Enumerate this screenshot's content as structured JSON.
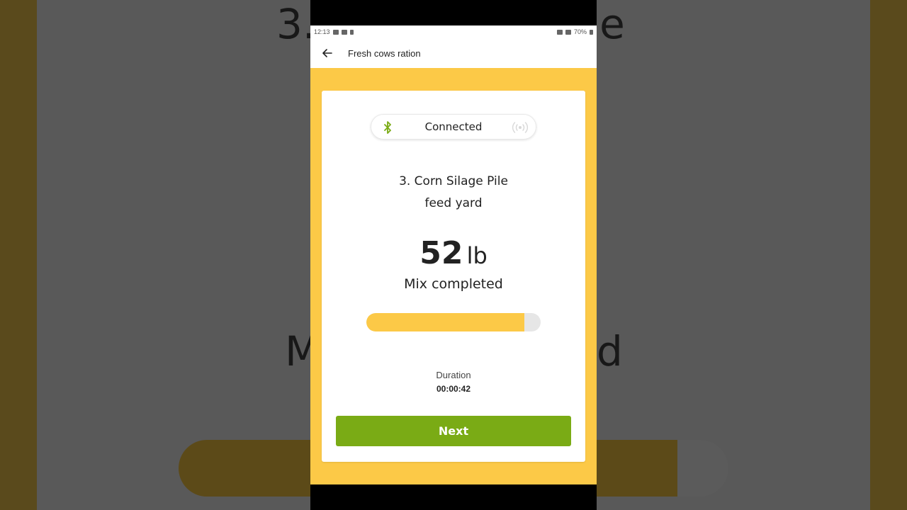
{
  "background": {
    "echo_top": "3.",
    "echo_top_right": "le",
    "echo_mid_left": "M",
    "echo_mid_right": "d"
  },
  "statusbar": {
    "time": "12:13",
    "battery": "70%"
  },
  "appbar": {
    "back_icon": "arrow-left-icon",
    "title": "Fresh cows ration"
  },
  "connection": {
    "status": "Connected",
    "bluetooth_icon": "bluetooth-icon",
    "signal_icon": "broadcast-signal-icon",
    "bluetooth_color": "#7aab15"
  },
  "item": {
    "line1": "3. Corn Silage Pile",
    "line2": "feed yard"
  },
  "weight": {
    "value": "52",
    "unit": "lb",
    "status": "Mix completed"
  },
  "progress": {
    "fraction": 0.907
  },
  "duration": {
    "label": "Duration",
    "value": "00:00:42"
  },
  "actions": {
    "next_label": "Next"
  },
  "colors": {
    "accent_yellow": "#fcc947",
    "primary_green": "#7aab15"
  }
}
